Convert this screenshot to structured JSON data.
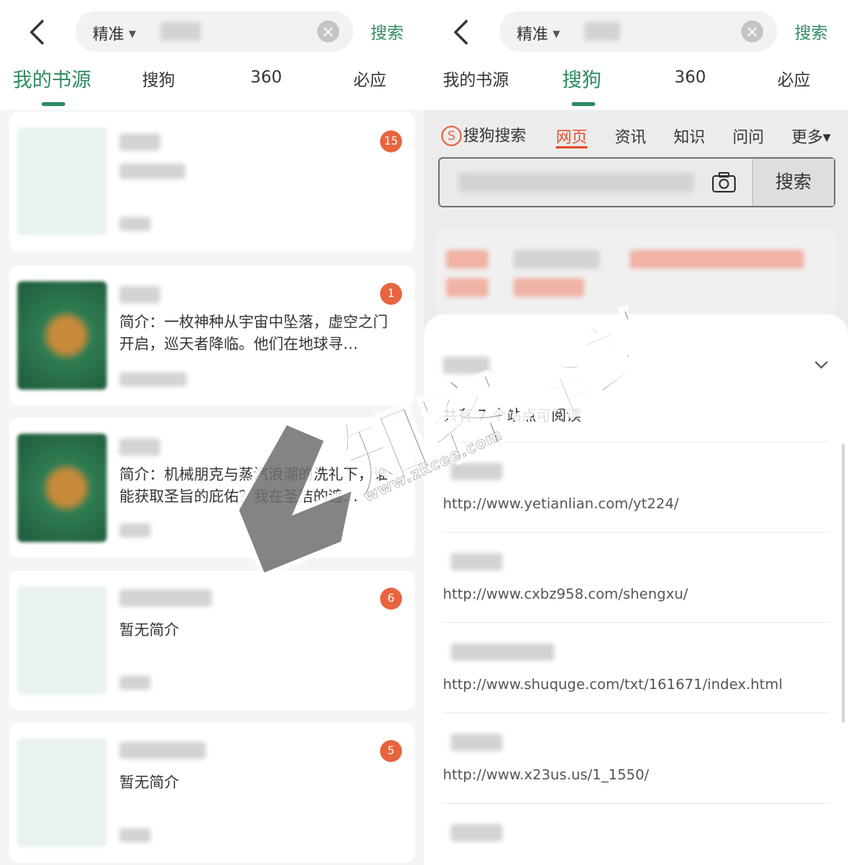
{
  "left": {
    "search": {
      "mode": "精准",
      "clear": "×",
      "button": "搜索"
    },
    "tabs": [
      "我的书源",
      "搜狗",
      "360",
      "必应"
    ],
    "active_tab": 0,
    "books": [
      {
        "badge": "15",
        "desc": "",
        "cover": "plain"
      },
      {
        "badge": "1",
        "desc": "简介：一枚神种从宇宙中坠落，虚空之门开启，巡天者降临。他们在地球寻…",
        "cover": "art"
      },
      {
        "badge": "",
        "desc": "简介：机械朋克与蒸汽浪潮的洗礼下，谁能获取圣旨的庇佑？我在圣洁的遮…",
        "cover": "art"
      },
      {
        "badge": "6",
        "desc": "暂无简介",
        "cover": "plain"
      },
      {
        "badge": "5",
        "desc": "暂无简介",
        "cover": "plain"
      }
    ]
  },
  "right": {
    "search": {
      "mode": "精准",
      "clear": "×",
      "button": "搜索"
    },
    "tabs": [
      "我的书源",
      "搜狗",
      "360",
      "必应"
    ],
    "active_tab": 1,
    "sogou": {
      "logo": "搜狗搜索",
      "logo_letter": "S",
      "nav": [
        "网页",
        "资讯",
        "知识",
        "问问",
        "更多▾"
      ],
      "search_button": "搜索"
    },
    "sheet": {
      "title": "共有 7 个站点可阅读",
      "sites": [
        {
          "url": "http://www.yetianlian.com/yt224/"
        },
        {
          "url": "http://www.cxbz958.com/shengxu/"
        },
        {
          "url": "http://www.shuquge.com/txt/161671/index.html"
        },
        {
          "url": "http://www.x23us.us/1_1550/"
        },
        {
          "url": ""
        }
      ]
    }
  },
  "watermark": {
    "text": "知客驿站",
    "url": "www.zkcee.com"
  },
  "colors": {
    "accent": "#2e8b61",
    "badge": "#e8643f",
    "sogou_red": "#e34f30"
  }
}
